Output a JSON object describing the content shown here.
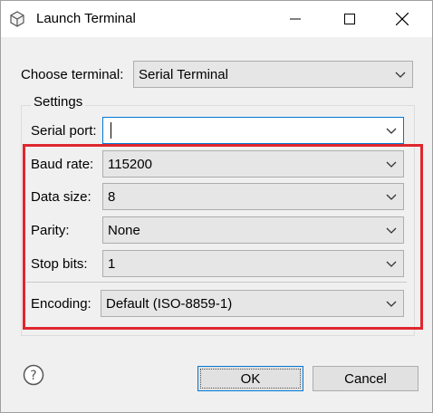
{
  "window": {
    "title": "Launch Terminal",
    "icons": [
      "terminal-app-icon",
      "minimize-icon",
      "maximize-icon",
      "close-icon"
    ]
  },
  "choose_terminal": {
    "label": "Choose terminal:",
    "value": "Serial Terminal"
  },
  "settings": {
    "title": "Settings",
    "serial_port": {
      "label": "Serial port:",
      "value": ""
    },
    "baud_rate": {
      "label": "Baud rate:",
      "value": "115200"
    },
    "data_size": {
      "label": "Data size:",
      "value": "8"
    },
    "parity": {
      "label": "Parity:",
      "value": "None"
    },
    "stop_bits": {
      "label": "Stop bits:",
      "value": "1"
    },
    "encoding": {
      "label": "Encoding:",
      "value": "Default (ISO-8859-1)"
    }
  },
  "footer": {
    "help_icon": "help-icon",
    "ok_label": "OK",
    "cancel_label": "Cancel"
  },
  "colors": {
    "highlight": "#e0262e",
    "focus_border": "#0078d7"
  }
}
